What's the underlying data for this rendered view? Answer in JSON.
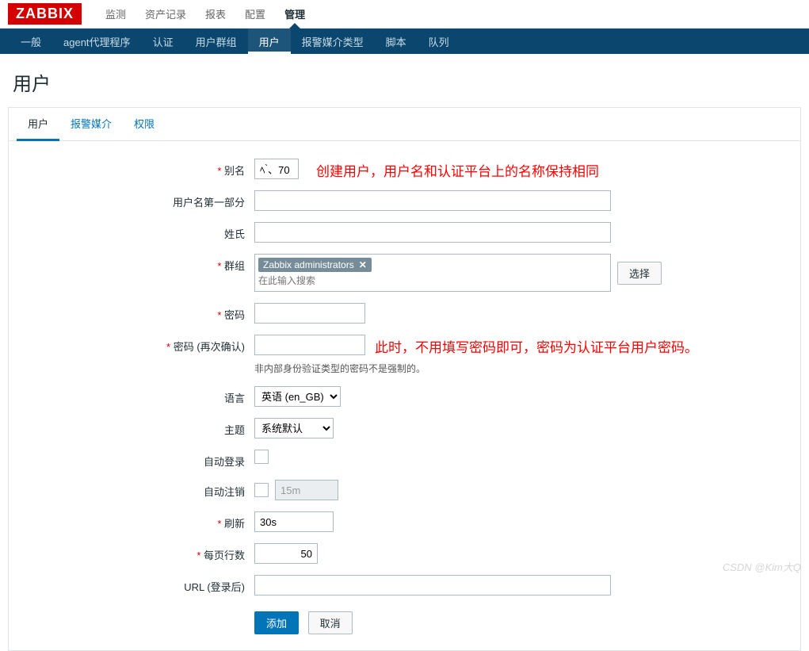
{
  "logo": "ZABBIX",
  "topnav": {
    "items": [
      "监测",
      "资产记录",
      "报表",
      "配置",
      "管理"
    ],
    "activeIndex": 4
  },
  "subnav": {
    "items": [
      "一般",
      "agent代理程序",
      "认证",
      "用户群组",
      "用户",
      "报警媒介类型",
      "脚本",
      "队列"
    ],
    "activeIndex": 4
  },
  "page": {
    "title": "用户"
  },
  "tabs": {
    "items": [
      "用户",
      "报警媒介",
      "权限"
    ],
    "activeIndex": 0
  },
  "form": {
    "alias": {
      "label": "别名",
      "value": "ﾍ ̀、70"
    },
    "firstname": {
      "label": "用户名第一部分",
      "value": ""
    },
    "surname": {
      "label": "姓氏",
      "value": ""
    },
    "groups": {
      "label": "群组",
      "tag": "Zabbix administrators",
      "placeholder": "在此输入搜索",
      "selectBtn": "选择"
    },
    "password": {
      "label": "密码",
      "value": ""
    },
    "passwordConfirm": {
      "label": "密码 (再次确认)",
      "value": ""
    },
    "passwordHint": "非内部身份验证类型的密码不是强制的。",
    "language": {
      "label": "语言",
      "value": "英语 (en_GB)"
    },
    "theme": {
      "label": "主题",
      "value": "系统默认"
    },
    "autoLogin": {
      "label": "自动登录"
    },
    "autoLogout": {
      "label": "自动注销",
      "value": "15m"
    },
    "refresh": {
      "label": "刷新",
      "value": "30s"
    },
    "rowsPerPage": {
      "label": "每页行数",
      "value": "50"
    },
    "url": {
      "label": "URL (登录后)",
      "value": ""
    },
    "add": "添加",
    "cancel": "取消"
  },
  "annotations": {
    "a1": "创建用户，用户名和认证平台上的名称保持相同",
    "a2": "此时，不用填写密码即可，密码为认证平台用户密码。"
  },
  "watermark": "CSDN @Kim大Q"
}
